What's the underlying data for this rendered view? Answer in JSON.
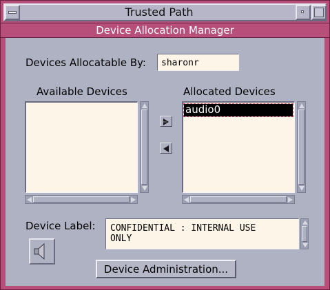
{
  "window": {
    "title": "Trusted Path",
    "banner": "Device Allocation Manager"
  },
  "form": {
    "allocatable_label": "Devices Allocatable By:",
    "allocatable_value": "sharonr",
    "available_header": "Available Devices",
    "allocated_header": "Allocated Devices",
    "available_items": [],
    "allocated_items": [
      "audio0"
    ],
    "selected_allocated": "audio0",
    "device_label_caption": "Device Label:",
    "device_label_value": "CONFIDENTIAL : INTERNAL USE\nONLY",
    "admin_button": "Device Administration..."
  },
  "icons": {
    "allocate": "arrow-right-icon",
    "deallocate": "arrow-left-icon",
    "device_type": "speaker-icon"
  },
  "colors": {
    "frame": "#b84f7a",
    "background": "#aeb2c3",
    "field": "#fdf5e8",
    "selection": "#000000"
  }
}
